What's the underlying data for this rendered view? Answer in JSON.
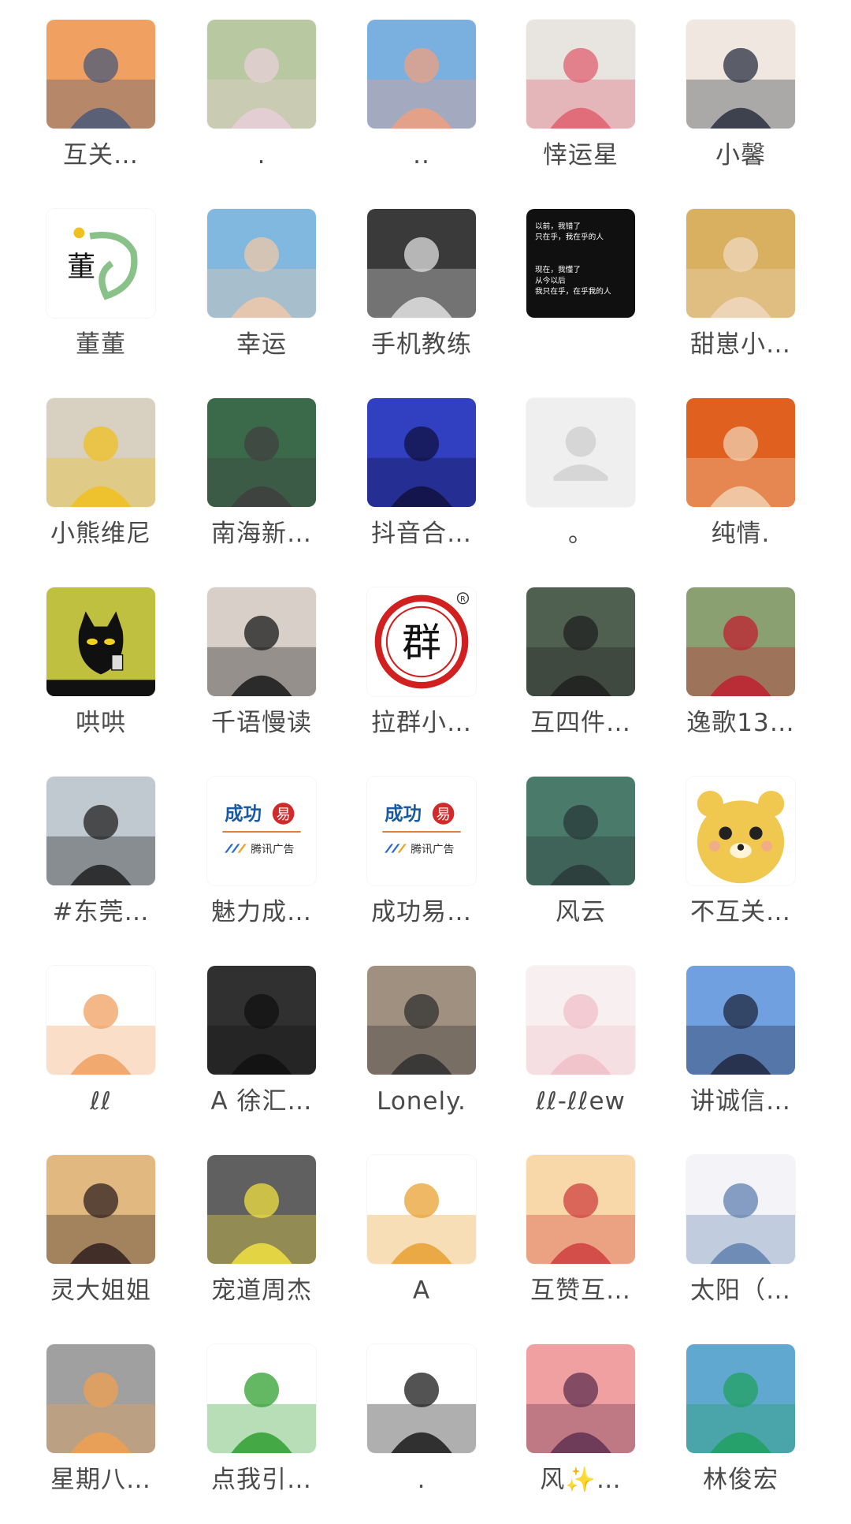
{
  "contacts": [
    {
      "label": "互关…",
      "icon": "sunset-man-avatar",
      "colors": [
        "#f0a060",
        "#4a5a7a"
      ]
    },
    {
      "label": ".",
      "icon": "girl-grass-avatar",
      "colors": [
        "#b8c8a0",
        "#e8d0d8"
      ]
    },
    {
      "label": "..",
      "icon": "anime-boy-avatar",
      "colors": [
        "#7ab0e0",
        "#f0a080"
      ]
    },
    {
      "label": "悻运星",
      "icon": "cartoon-doll-avatar",
      "colors": [
        "#e8e4e0",
        "#e06070"
      ]
    },
    {
      "label": "小馨",
      "icon": "woman-selfie-avatar",
      "colors": [
        "#f0e8e0",
        "#2a3040"
      ]
    },
    {
      "label": "董董",
      "icon": "calligraphy-avatar",
      "colors": [
        "#ffffff",
        "#3a9a3a"
      ]
    },
    {
      "label": "幸运",
      "icon": "cartoon-girl-avatar",
      "colors": [
        "#80b8e0",
        "#f0c8a8"
      ]
    },
    {
      "label": "手机教练",
      "icon": "two-women-photo-avatar",
      "colors": [
        "#3a3a3a",
        "#e0e0e0"
      ]
    },
    {
      "label": "",
      "icon": "text-quote-avatar",
      "colors": [
        "#101010",
        "#ffffff"
      ]
    },
    {
      "label": "甜崽小…",
      "icon": "blonde-girl-avatar",
      "colors": [
        "#d8b060",
        "#f0d8c0"
      ]
    },
    {
      "label": "小熊维尼",
      "icon": "sunflower-girl-avatar",
      "colors": [
        "#d8d0c0",
        "#f0c020"
      ]
    },
    {
      "label": "南海新…",
      "icon": "girl-bicycle-avatar",
      "colors": [
        "#3a6a4a",
        "#404040"
      ]
    },
    {
      "label": "抖音合…",
      "icon": "shadow-silhouette-avatar",
      "colors": [
        "#3040c0",
        "#101040"
      ]
    },
    {
      "label": "。",
      "icon": "default-user-avatar",
      "colors": [
        "#efefef",
        "#d6d6d6"
      ]
    },
    {
      "label": "纯情.",
      "icon": "kid-hood-avatar",
      "colors": [
        "#e06020",
        "#f0d0b0"
      ]
    },
    {
      "label": "哄哄",
      "icon": "black-cat-avatar",
      "colors": [
        "#c0c040",
        "#101010"
      ]
    },
    {
      "label": "千语慢读",
      "icon": "woman-portrait-avatar",
      "colors": [
        "#d8d0c8",
        "#1a1a1a"
      ]
    },
    {
      "label": "拉群小…",
      "icon": "group-stamp-avatar",
      "colors": [
        "#ffffff",
        "#d02020"
      ]
    },
    {
      "label": "互四件…",
      "icon": "boy-portrait-avatar",
      "colors": [
        "#506050",
        "#202020"
      ]
    },
    {
      "label": "逸歌13…",
      "icon": "woman-traditional-avatar",
      "colors": [
        "#8aa070",
        "#c02030"
      ]
    },
    {
      "label": "#东莞…",
      "icon": "woman-mall-avatar",
      "colors": [
        "#c0c8d0",
        "#202020"
      ]
    },
    {
      "label": "魅力成…",
      "icon": "tencent-ad-logo",
      "colors": [
        "#ffffff",
        "#1a5aa0"
      ]
    },
    {
      "label": "成功易…",
      "icon": "tencent-ad-logo",
      "colors": [
        "#ffffff",
        "#1a5aa0"
      ]
    },
    {
      "label": "风云",
      "icon": "bridge-water-avatar",
      "colors": [
        "#4a7a6a",
        "#2a3a3a"
      ]
    },
    {
      "label": "不互关…",
      "icon": "cartoon-bear-avatar",
      "colors": [
        "#ffffff",
        "#f0c850"
      ]
    },
    {
      "label": "ℓℓ",
      "icon": "cartoon-cat-avatar",
      "colors": [
        "#ffffff",
        "#f0a060"
      ]
    },
    {
      "label": "A 徐汇…",
      "icon": "man-suit-avatar",
      "colors": [
        "#303030",
        "#101010"
      ]
    },
    {
      "label": "Lonely.",
      "icon": "boy-car-avatar",
      "colors": [
        "#a09080",
        "#303030"
      ]
    },
    {
      "label": "ℓℓ-ℓℓew",
      "icon": "baby-pink-avatar",
      "colors": [
        "#f8f0f0",
        "#f0c0c8"
      ]
    },
    {
      "label": "讲诚信…",
      "icon": "sky-silhouette-avatar",
      "colors": [
        "#70a0e0",
        "#202840"
      ]
    },
    {
      "label": "灵大姐姐",
      "icon": "woman-sunset-avatar",
      "colors": [
        "#e0b880",
        "#302020"
      ]
    },
    {
      "label": "宠道周杰",
      "icon": "man-dog-avatar",
      "colors": [
        "#606060",
        "#f0e040"
      ]
    },
    {
      "label": "A",
      "icon": "cartoon-pirate-avatar",
      "colors": [
        "#ffffff",
        "#e8a030"
      ]
    },
    {
      "label": "互赞互…",
      "icon": "cartoon-family-avatar",
      "colors": [
        "#f8d8a8",
        "#d04040"
      ]
    },
    {
      "label": "太阳（…",
      "icon": "sketch-girl-avatar",
      "colors": [
        "#f4f4f8",
        "#6080b0"
      ]
    },
    {
      "label": "星期八…",
      "icon": "corgi-dog-avatar",
      "colors": [
        "#a0a0a0",
        "#f0a050"
      ]
    },
    {
      "label": "点我引…",
      "icon": "green-plant-avatar",
      "colors": [
        "#ffffff",
        "#30a030"
      ]
    },
    {
      "label": ".",
      "icon": "anime-woman-avatar",
      "colors": [
        "#ffffff",
        "#1a1a1a"
      ]
    },
    {
      "label": "风✨…",
      "icon": "sunset-kids-avatar",
      "colors": [
        "#f0a0a0",
        "#603050"
      ]
    },
    {
      "label": "林俊宏",
      "icon": "dragon-avatar",
      "colors": [
        "#60a8d0",
        "#20a060"
      ]
    }
  ]
}
